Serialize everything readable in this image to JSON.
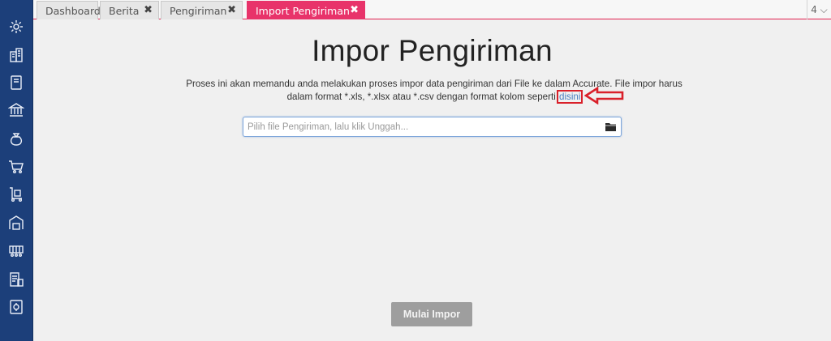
{
  "tabs": [
    {
      "label": "Dashboard",
      "closable": false
    },
    {
      "label": "Berita",
      "closable": true,
      "close": "✖"
    },
    {
      "label": "Pengiriman",
      "closable": true,
      "close": "✖"
    },
    {
      "label": "Import Pengiriman",
      "closable": true,
      "active": true,
      "close": "✖"
    }
  ],
  "tab_count": "4 ⌵",
  "sidebar_icons": [
    "gear-icon",
    "building-icon",
    "book-icon",
    "bank-icon",
    "money-bag-icon",
    "cart-icon",
    "trolley-icon",
    "warehouse-icon",
    "conveyor-icon",
    "tax-report-icon",
    "settings-report-icon"
  ],
  "main": {
    "title": "Impor Pengiriman",
    "desc_part1": "Proses ini akan memandu anda melakukan proses impor data pengiriman dari File ke dalam Accurate. File impor harus dalam format *.xls, *.xlsx atau *.csv dengan format kolom seperti",
    "desc_link": "disini",
    "file_placeholder": "Pilih file Pengiriman, lalu klik Unggah...",
    "submit_label": "Mulai Impor"
  },
  "colors": {
    "sidebar": "#1c3f7a",
    "active_tab": "#e8336a",
    "annotation": "#d9202a",
    "button": "#9e9e9e"
  }
}
